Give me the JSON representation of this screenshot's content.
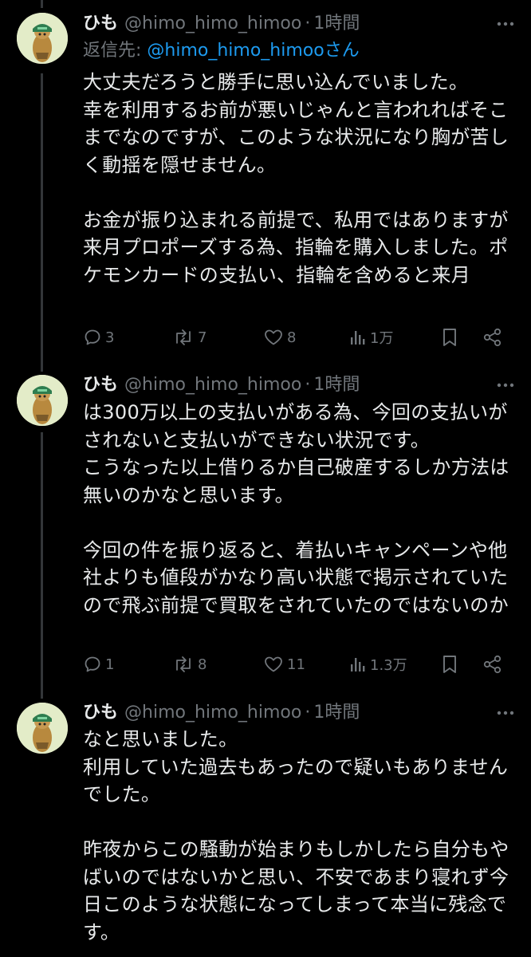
{
  "posts": [
    {
      "name": "ひも",
      "handle": "@himo_himo_himoo",
      "separator": "·",
      "time": "1時間",
      "reply_prefix": "返信先: ",
      "reply_handle": "@himo_himo_himooさん",
      "text": "大丈夫だろうと勝手に思い込んでいました。\n幸を利用するお前が悪いじゃんと言われればそこまでなのですが、このような状況になり胸が苦しく動揺を隠せません。\n\nお金が振り込まれる前提で、私用ではありますが来月プロポーズする為、指輪を購入しました。ポケモンカードの支払い、指輪を含めると来月",
      "replies": "3",
      "reposts": "7",
      "likes": "8",
      "views": "1万"
    },
    {
      "name": "ひも",
      "handle": "@himo_himo_himoo",
      "separator": "·",
      "time": "1時間",
      "text": "は300万以上の支払いがある為、今回の支払いがされないと支払いができない状況です。\nこうなった以上借りるか自己破産するしか方法は無いのかなと思います。\n\n今回の件を振り返ると、着払いキャンペーンや他社よりも値段がかなり高い状態で掲示されていたので飛ぶ前提で買取をされていたのではないのか",
      "replies": "1",
      "reposts": "8",
      "likes": "11",
      "views": "1.3万"
    },
    {
      "name": "ひも",
      "handle": "@himo_himo_himoo",
      "separator": "·",
      "time": "1時間",
      "text": "なと思いました。\n利用していた過去もあったので疑いもありませんでした。\n\n昨夜からこの騒動が始まりもしかしたら自分もやばいのではないかと思い、不安であまり寝れず今日このような状態になってしまって本当に残念です。"
    }
  ],
  "icons": {
    "reply": "reply-icon",
    "repost": "repost-icon",
    "like": "heart-icon",
    "views": "views-icon",
    "bookmark": "bookmark-icon",
    "share": "share-icon",
    "more": "more-icon"
  },
  "colors": {
    "background": "#000000",
    "text": "#e7e9ea",
    "muted": "#71767b",
    "link": "#1d9bf0",
    "thread_line": "#333639"
  }
}
